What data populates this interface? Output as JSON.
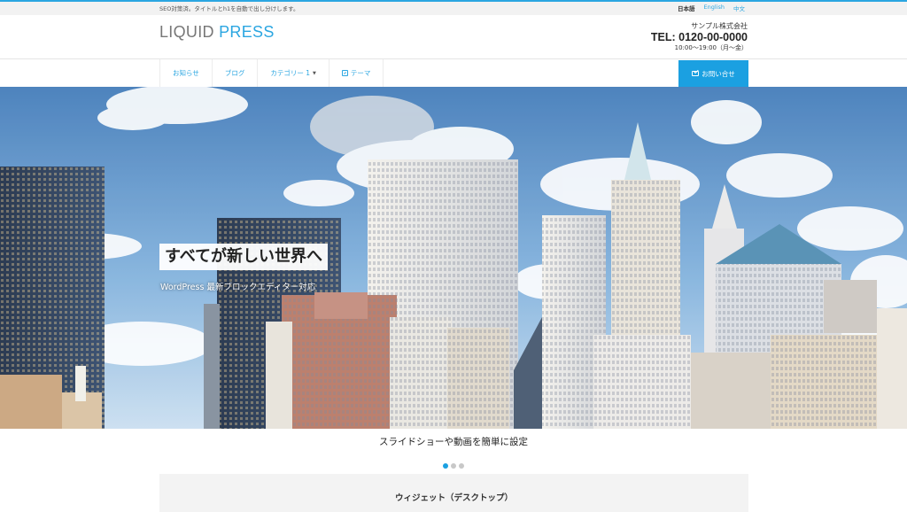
{
  "topbar": {
    "description": "SEO対策済。タイトルとh1を自動で出し分けします。",
    "languages": [
      "日本語",
      "English",
      "中文"
    ]
  },
  "header": {
    "logo_part1": "LIQUID",
    "logo_part2": "PRESS",
    "company_name": "サンプル株式会社",
    "tel": "TEL: 0120-00-0000",
    "hours": "10:00〜19:00（月〜金）"
  },
  "nav": {
    "items": [
      {
        "label": "お知らせ"
      },
      {
        "label": "ブログ"
      },
      {
        "label": "カテゴリー 1",
        "icon": "caret-down"
      },
      {
        "label": "テーマ",
        "icon": "edit-icon"
      }
    ],
    "contact_label": "お問い合せ",
    "contact_icon": "mail-icon"
  },
  "hero": {
    "title": "すべてが新しい世界へ",
    "subtitle": "WordPress 最新ブロックエディター対応"
  },
  "slider": {
    "caption": "スライドショーや動画を簡単に設定",
    "active_slide": 1,
    "total_slides": 3
  },
  "widget": {
    "title": "ウィジェット（デスクトップ）"
  },
  "colors": {
    "accent": "#1ba0e1",
    "topbar_bg": "#f2f2f2",
    "widget_bg": "#f3f3f3"
  }
}
